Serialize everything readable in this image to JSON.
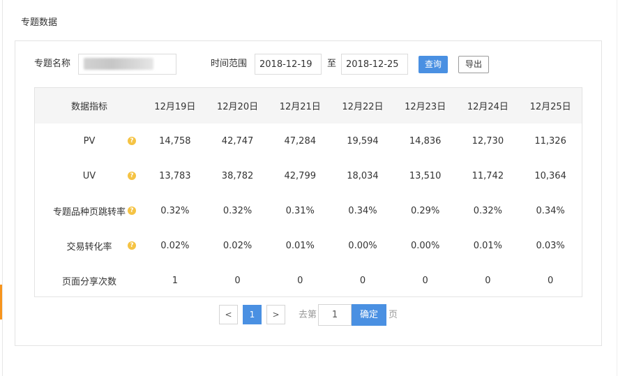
{
  "page_title": "专题数据",
  "colors": {
    "accent": "#4a90e2",
    "help": "#f5c343",
    "side_marker": "#f7941d",
    "header_bg": "#f5f5f5"
  },
  "filter": {
    "name_label": "专题名称",
    "name_value": "",
    "time_label": "时间范围",
    "start_date": "2018-12-19",
    "range_sep": "至",
    "end_date": "2018-12-25",
    "query_label": "查询",
    "export_label": "导出"
  },
  "table": {
    "headers": [
      "数据指标",
      "12月19日",
      "12月20日",
      "12月21日",
      "12月22日",
      "12月23日",
      "12月24日",
      "12月25日"
    ],
    "rows": [
      {
        "label": "PV",
        "help": true,
        "values": [
          "14,758",
          "42,747",
          "47,284",
          "19,594",
          "14,836",
          "12,730",
          "11,326"
        ]
      },
      {
        "label": "UV",
        "help": true,
        "values": [
          "13,783",
          "38,782",
          "42,799",
          "18,034",
          "13,510",
          "11,742",
          "10,364"
        ]
      },
      {
        "label": "专题品种页跳转率",
        "help": true,
        "values": [
          "0.32%",
          "0.32%",
          "0.31%",
          "0.34%",
          "0.29%",
          "0.32%",
          "0.34%"
        ]
      },
      {
        "label": "交易转化率",
        "help": true,
        "values": [
          "0.02%",
          "0.02%",
          "0.01%",
          "0.00%",
          "0.00%",
          "0.01%",
          "0.03%"
        ]
      },
      {
        "label": "页面分享次数",
        "help": false,
        "values": [
          "1",
          "0",
          "0",
          "0",
          "0",
          "0",
          "0"
        ]
      }
    ]
  },
  "pagination": {
    "prev": "<",
    "current_page": "1",
    "next": ">",
    "goto_label": "去第",
    "goto_value": "1",
    "confirm_label": "确定",
    "page_suffix": "页"
  }
}
